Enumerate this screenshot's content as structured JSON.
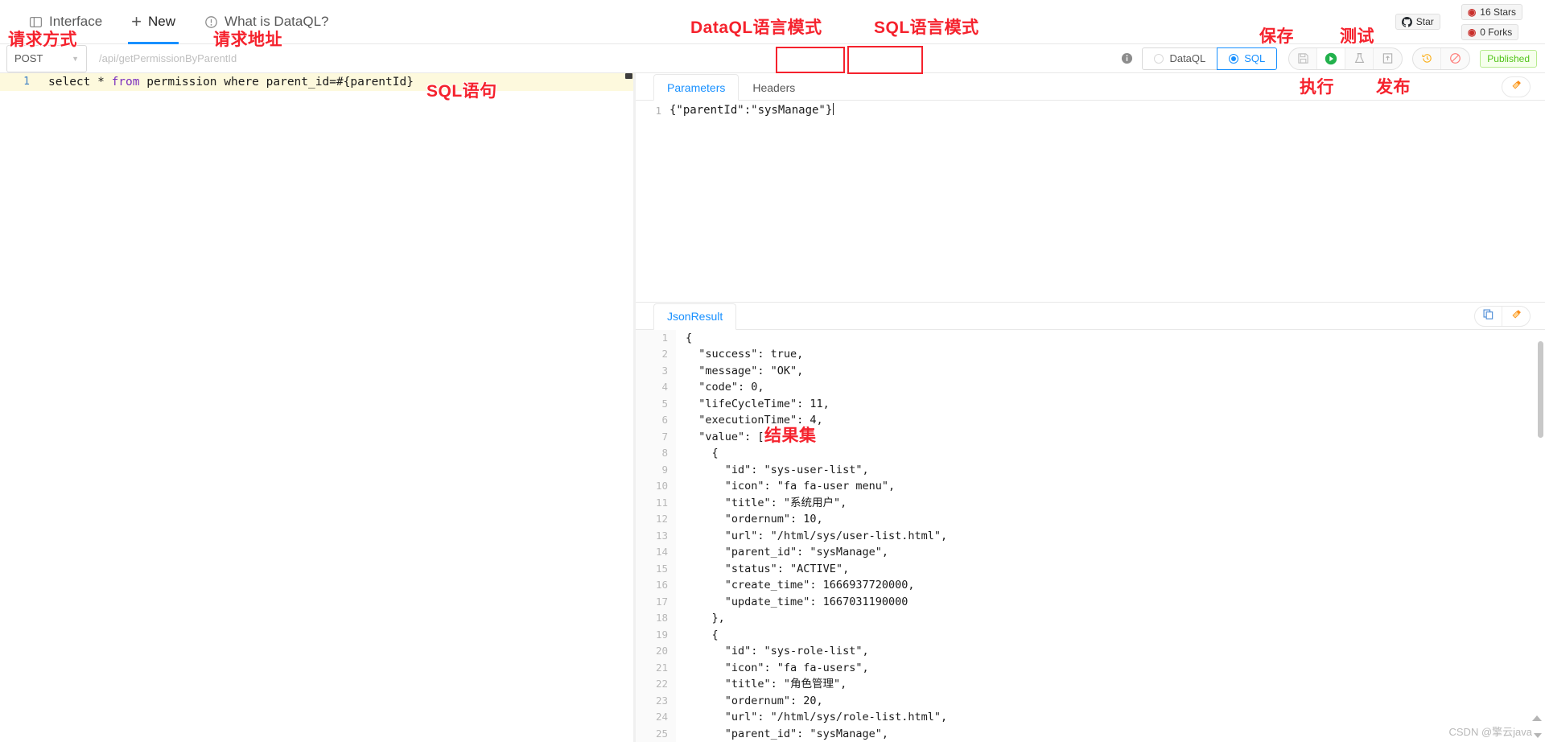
{
  "header": {
    "nav": [
      {
        "label": "Interface",
        "icon": "interface-icon",
        "active": false
      },
      {
        "label": "New",
        "icon": "plus-icon",
        "active": true
      },
      {
        "label": "What is DataQL?",
        "icon": "question-circle-icon",
        "active": false
      }
    ],
    "github": {
      "star_label": "Star",
      "stars_label": "16 Stars",
      "forks_label": "0 Forks"
    }
  },
  "urlbar": {
    "method": "POST",
    "url_placeholder": "/api/getPermissionByParentId",
    "url_value": "",
    "info_icon": "info-icon",
    "language_modes": [
      {
        "label": "DataQL",
        "selected": false
      },
      {
        "label": "SQL",
        "selected": true
      }
    ],
    "tools": [
      {
        "name": "save-icon",
        "label": "Save"
      },
      {
        "name": "run-icon",
        "label": "Run"
      },
      {
        "name": "test-flask-icon",
        "label": "Test"
      },
      {
        "name": "publish-icon",
        "label": "Publish"
      },
      {
        "name": "history-icon",
        "label": "History"
      },
      {
        "name": "disable-icon",
        "label": "Disable"
      }
    ],
    "status_badge": "Published"
  },
  "editor": {
    "line_number": "1",
    "sql_prefix": "select * ",
    "sql_keyword": "from",
    "sql_suffix": " permission where parent_id=#{parentId}"
  },
  "params": {
    "tabs": [
      {
        "label": "Parameters",
        "active": true
      },
      {
        "label": "Headers",
        "active": false
      }
    ],
    "line_number": "1",
    "content": "{\"parentId\":\"sysManage\"}",
    "pin_icon": "pin-icon"
  },
  "result": {
    "tabs": [
      {
        "label": "JsonResult",
        "active": true
      }
    ],
    "copy_icon": "copy-icon",
    "pin_icon": "pin-icon",
    "lines": [
      {
        "n": "1",
        "t": "{"
      },
      {
        "n": "2",
        "t": "  \"success\": true,"
      },
      {
        "n": "3",
        "t": "  \"message\": \"OK\","
      },
      {
        "n": "4",
        "t": "  \"code\": 0,"
      },
      {
        "n": "5",
        "t": "  \"lifeCycleTime\": 11,"
      },
      {
        "n": "6",
        "t": "  \"executionTime\": 4,"
      },
      {
        "n": "7",
        "t": "  \"value\": ["
      },
      {
        "n": "8",
        "t": "    {"
      },
      {
        "n": "9",
        "t": "      \"id\": \"sys-user-list\","
      },
      {
        "n": "10",
        "t": "      \"icon\": \"fa fa-user menu\","
      },
      {
        "n": "11",
        "t": "      \"title\": \"系统用户\","
      },
      {
        "n": "12",
        "t": "      \"ordernum\": 10,"
      },
      {
        "n": "13",
        "t": "      \"url\": \"/html/sys/user-list.html\","
      },
      {
        "n": "14",
        "t": "      \"parent_id\": \"sysManage\","
      },
      {
        "n": "15",
        "t": "      \"status\": \"ACTIVE\","
      },
      {
        "n": "16",
        "t": "      \"create_time\": 1666937720000,"
      },
      {
        "n": "17",
        "t": "      \"update_time\": 1667031190000"
      },
      {
        "n": "18",
        "t": "    },"
      },
      {
        "n": "19",
        "t": "    {"
      },
      {
        "n": "20",
        "t": "      \"id\": \"sys-role-list\","
      },
      {
        "n": "21",
        "t": "      \"icon\": \"fa fa-users\","
      },
      {
        "n": "22",
        "t": "      \"title\": \"角色管理\","
      },
      {
        "n": "23",
        "t": "      \"ordernum\": 20,"
      },
      {
        "n": "24",
        "t": "      \"url\": \"/html/sys/role-list.html\","
      },
      {
        "n": "25",
        "t": "      \"parent_id\": \"sysManage\","
      }
    ]
  },
  "annotations": {
    "request_method": "请求方式",
    "request_url": "请求地址",
    "dataql_mode": "DataQL语言模式",
    "sql_mode": "SQL语言模式",
    "save": "保存",
    "test": "测试",
    "run": "执行",
    "publish": "发布",
    "sql_statement": "SQL语句",
    "result_set": "结果集"
  },
  "watermark": "CSDN @擎云java",
  "colors": {
    "accent": "#1890ff",
    "annotation": "#f5222d",
    "run_green": "#22b14c",
    "published_green": "#52c41a",
    "highlight_line": "#fdf9dd"
  }
}
